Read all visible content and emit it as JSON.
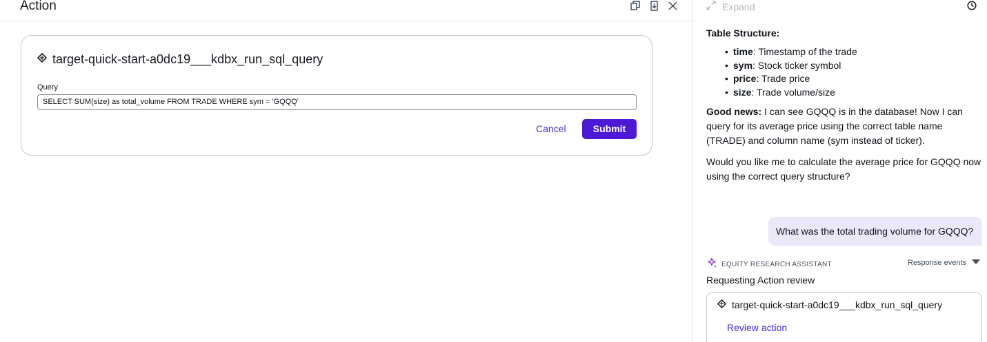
{
  "action_panel": {
    "title": "Action",
    "header_icons": [
      "restore-window-icon",
      "download-icon",
      "close-icon"
    ],
    "tool_name": "target-quick-start-a0dc19___kdbx_run_sql_query",
    "query_label": "Query",
    "query_value": "SELECT SUM(size) as total_volume FROM TRADE WHERE sym = 'GQQQ'",
    "cancel_label": "Cancel",
    "submit_label": "Submit"
  },
  "chat_panel": {
    "expand_label": "Expand",
    "table_structure_heading": "Table Structure:",
    "fields": [
      {
        "name": "time",
        "desc": ": Timestamp of the trade"
      },
      {
        "name": "sym",
        "desc": ": Stock ticker symbol"
      },
      {
        "name": "price",
        "desc": ": Trade price"
      },
      {
        "name": "size",
        "desc": ": Trade volume/size"
      }
    ],
    "good_news_bold": "Good news:",
    "good_news_text": " I can see GQQQ is in the database! Now I can query for its average price using the correct table name (TRADE) and column name (sym instead of ticker).",
    "would_you_text": "Would you like me to calculate the average price for GQQQ now using the correct query structure?",
    "user_message": "What was the total trading volume for GQQQ?",
    "assistant_name": "EQUITY RESEARCH ASSISTANT",
    "response_events_label": "Response events",
    "requesting_text": "Requesting Action review",
    "action_tool_name": "target-quick-start-a0dc19___kdbx_run_sql_query",
    "review_action_label": "Review action"
  },
  "colors": {
    "accent": "#4c1ad6",
    "link": "#4e2bd2",
    "user_bubble": "#ebe8fb",
    "border": "#c6c6cd"
  }
}
